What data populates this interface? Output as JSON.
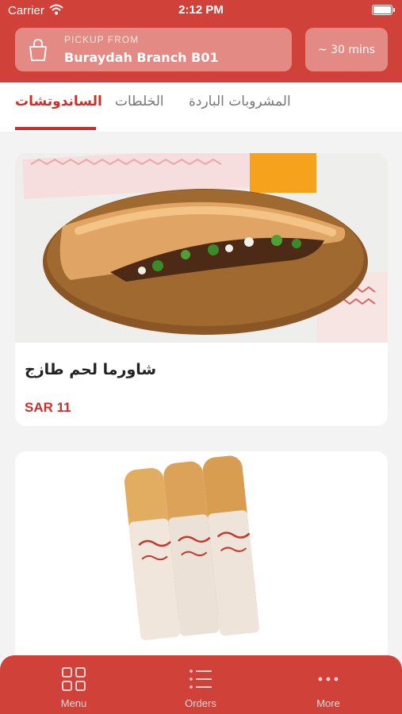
{
  "status_bar": {
    "carrier": "Carrier",
    "time": "2:12 PM"
  },
  "header": {
    "pickup_label": "PICKUP FROM",
    "branch_name": "Buraydah Branch B01",
    "eta": "~ 30 mins"
  },
  "tabs": [
    {
      "label": "الساندوتشات",
      "active": true
    },
    {
      "label": "الخلطات",
      "active": false
    },
    {
      "label": "المشروبات الباردة",
      "active": false
    }
  ],
  "products": [
    {
      "name": "شاورما لحم طازج",
      "price": "SAR 11"
    }
  ],
  "bottom_nav": [
    {
      "label": "Menu",
      "icon": "grid-icon"
    },
    {
      "label": "Orders",
      "icon": "list-icon"
    },
    {
      "label": "More",
      "icon": "more-dots-icon"
    }
  ],
  "colors": {
    "brand": "#d0413a",
    "accent": "#c9302c",
    "panel": "#e38a84",
    "background": "#f3f3f3"
  }
}
